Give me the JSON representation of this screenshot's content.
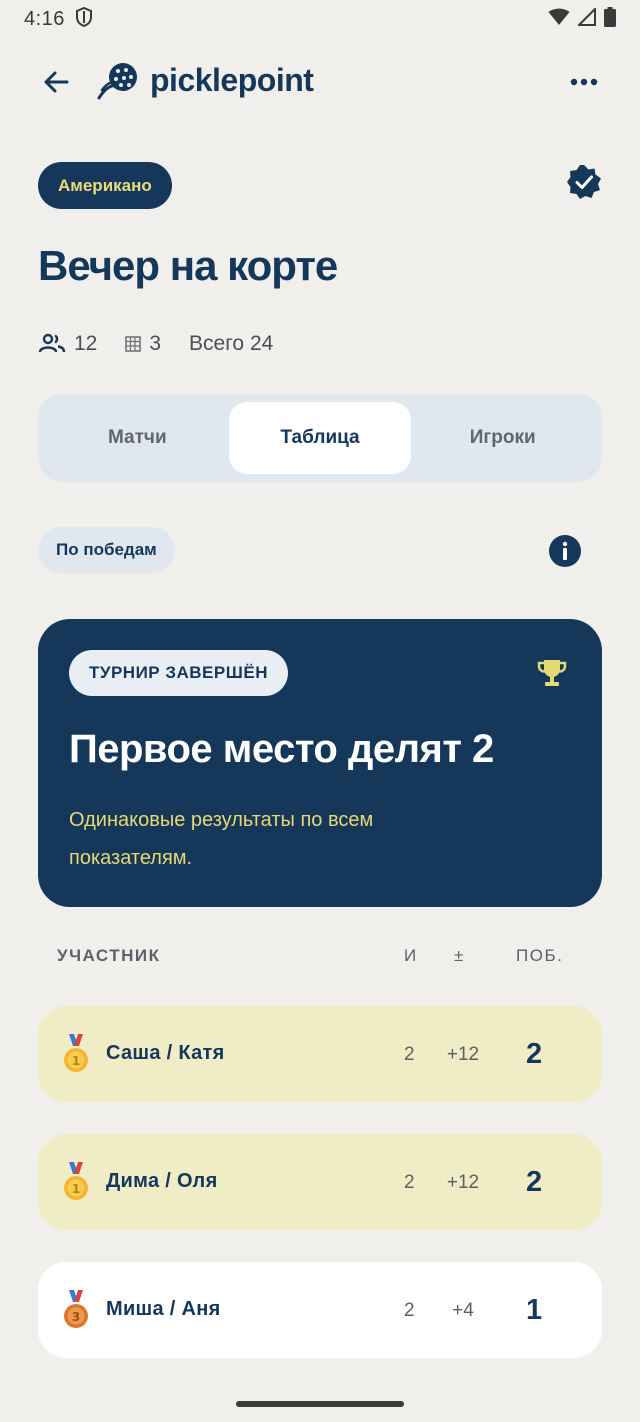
{
  "status_bar": {
    "time": "4:16"
  },
  "app_bar": {
    "logo_text": "picklepoint"
  },
  "tournament": {
    "format": "Американо",
    "title": "Вечер на корте",
    "players": "12",
    "courts": "3",
    "total": "Всего 24"
  },
  "tabs": [
    {
      "label": "Матчи",
      "active": false
    },
    {
      "label": "Таблица",
      "active": true
    },
    {
      "label": "Игроки",
      "active": false
    }
  ],
  "sort": {
    "label": "По победам"
  },
  "result": {
    "status": "ТУРНИР ЗАВЕРШЁН",
    "title": "Первое место делят 2",
    "subtitle": "Одинаковые результаты по всем показателям."
  },
  "table": {
    "headers": {
      "participant": "УЧАСТНИК",
      "games": "И",
      "diff": "±",
      "wins": "ПОБ."
    },
    "rows": [
      {
        "medal": "1",
        "name": "Саша / Катя",
        "games": "2",
        "diff": "+12",
        "wins": "2",
        "highlight": true
      },
      {
        "medal": "1",
        "name": "Дима / Оля",
        "games": "2",
        "diff": "+12",
        "wins": "2",
        "highlight": true
      },
      {
        "medal": "3",
        "name": "Миша / Аня",
        "games": "2",
        "diff": "+4",
        "wins": "1",
        "highlight": false
      }
    ]
  },
  "colors": {
    "primary": "#14375a",
    "accent": "#e6d873",
    "background": "#f0efeb",
    "gold_row": "#efecc6"
  }
}
